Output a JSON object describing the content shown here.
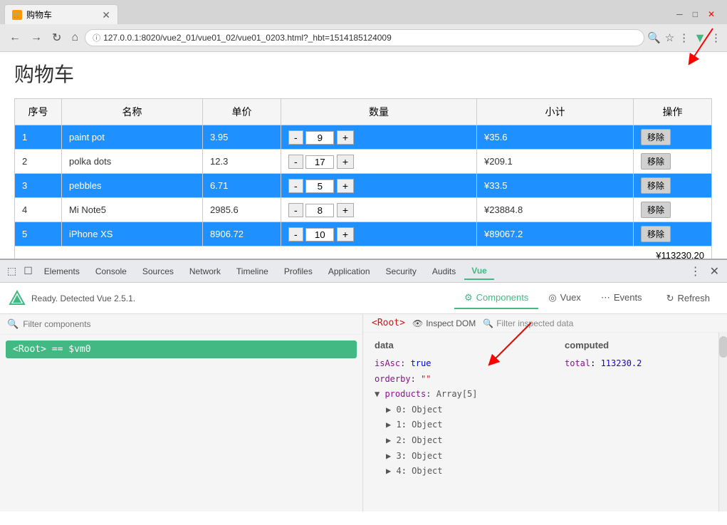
{
  "browser": {
    "tab_title": "购物车",
    "address": "127.0.0.1:8020/vue2_01/vue01_02/vue01_0203.html?_hbt=1514185124009",
    "favicon_char": "🛒"
  },
  "page": {
    "title": "购物车",
    "table": {
      "headers": [
        "序号",
        "名称",
        "单价",
        "数量",
        "小计",
        "操作"
      ],
      "rows": [
        {
          "id": "1",
          "name": "paint pot",
          "price": "3.95",
          "qty": "9",
          "subtotal": "¥35.6",
          "highlight": true
        },
        {
          "id": "2",
          "name": "polka dots",
          "price": "12.3",
          "qty": "17",
          "subtotal": "¥209.1",
          "highlight": false
        },
        {
          "id": "3",
          "name": "pebbles",
          "price": "6.71",
          "qty": "5",
          "subtotal": "¥33.5",
          "highlight": true
        },
        {
          "id": "4",
          "name": "Mi Note5",
          "price": "2985.6",
          "qty": "8",
          "subtotal": "¥23884.8",
          "highlight": false
        },
        {
          "id": "5",
          "name": "iPhone XS",
          "price": "8906.72",
          "qty": "10",
          "subtotal": "¥89067.2",
          "highlight": true
        }
      ],
      "total_label": "¥113230.20",
      "btn_remove": "移除"
    }
  },
  "devtools": {
    "tabs": [
      "Elements",
      "Console",
      "Sources",
      "Network",
      "Timeline",
      "Profiles",
      "Application",
      "Security",
      "Audits",
      "Vue"
    ],
    "active_tab": "Vue",
    "vue": {
      "status": "Ready. Detected Vue 2.5.1.",
      "tabs": [
        "Components",
        "Vuex",
        "Events"
      ],
      "active_tab": "Components",
      "refresh_label": "Refresh",
      "filter_placeholder": "Filter components",
      "root_item": "<Root> == $vm0",
      "right_header": {
        "root_tag": "<Root>",
        "inspect_dom": "Inspect DOM",
        "filter_placeholder": "Filter inspected data"
      },
      "data_panel": {
        "data_title": "data",
        "computed_title": "computed",
        "props": [
          {
            "key": "isAsc",
            "value": "true",
            "type": "bool"
          },
          {
            "key": "orderby",
            "value": "\"\"",
            "type": "str"
          },
          {
            "key": "▼ products",
            "value": "Array[5]",
            "type": "array",
            "expanded": true,
            "children": [
              {
                "key": "▶ 0",
                "value": "Object"
              },
              {
                "key": "▶ 1",
                "value": "Object"
              },
              {
                "key": "▶ 2",
                "value": "Object"
              },
              {
                "key": "▶ 3",
                "value": "Object"
              },
              {
                "key": "▶ 4",
                "value": "Object"
              }
            ]
          }
        ],
        "computed": [
          {
            "key": "total",
            "value": "113230.2"
          }
        ]
      }
    }
  }
}
